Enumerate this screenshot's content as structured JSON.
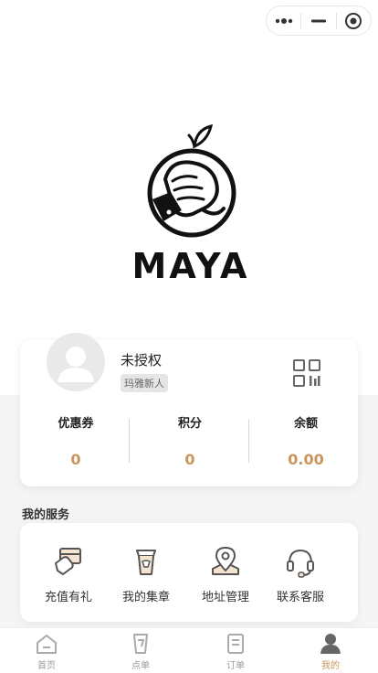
{
  "brand": {
    "name": "MAYA"
  },
  "user": {
    "name": "未授权",
    "badge": "玛雅新人"
  },
  "stats": [
    {
      "label": "优惠券",
      "value": "0"
    },
    {
      "label": "积分",
      "value": "0"
    },
    {
      "label": "余额",
      "value": "0.00"
    }
  ],
  "services": {
    "title": "我的服务",
    "items": [
      {
        "label": "充值有礼",
        "icon": "gift-card-hand-icon"
      },
      {
        "label": "我的集章",
        "icon": "stamp-cup-icon"
      },
      {
        "label": "地址管理",
        "icon": "location-pin-icon"
      },
      {
        "label": "联系客服",
        "icon": "headset-icon"
      }
    ]
  },
  "tabs": [
    {
      "label": "首页",
      "icon": "home-icon"
    },
    {
      "label": "点单",
      "icon": "order-cup-icon"
    },
    {
      "label": "订单",
      "icon": "order-list-icon"
    },
    {
      "label": "我的",
      "icon": "profile-icon",
      "active": true
    }
  ],
  "colors": {
    "accent": "#c9955d",
    "inactive": "#9a9a9a",
    "background": "#f5f5f5"
  }
}
